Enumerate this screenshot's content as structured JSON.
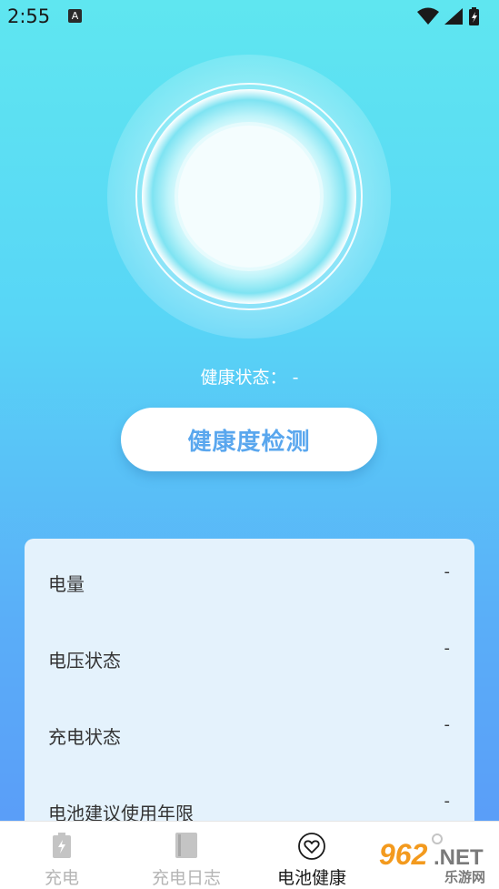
{
  "status_bar": {
    "time": "2:55",
    "notification_badge": "A"
  },
  "hero": {
    "icon": "glowing-ring"
  },
  "health_status": {
    "text": "健康状态： -"
  },
  "detect_button": {
    "label": "健康度检测"
  },
  "info_rows": [
    {
      "label": "电量",
      "value": "-"
    },
    {
      "label": "电压状态",
      "value": "-"
    },
    {
      "label": "充电状态",
      "value": "-"
    },
    {
      "label": "电池建议使用年限",
      "value": "-"
    }
  ],
  "bottom_nav": {
    "items": [
      {
        "label": "充电",
        "icon": "battery-icon",
        "active": false
      },
      {
        "label": "充电日志",
        "icon": "book-icon",
        "active": false
      },
      {
        "label": "电池健康",
        "icon": "heart-icon",
        "active": true
      },
      {
        "label": "",
        "icon": "person-icon",
        "active": false
      }
    ]
  },
  "watermark": {
    "text": "962.NET",
    "subtext": "乐游网"
  },
  "colors": {
    "button_text": "#5aa7ee",
    "card_bg": "#e4f2fc",
    "nav_active": "#1a1a1a",
    "nav_inactive": "#b5b5b5"
  }
}
